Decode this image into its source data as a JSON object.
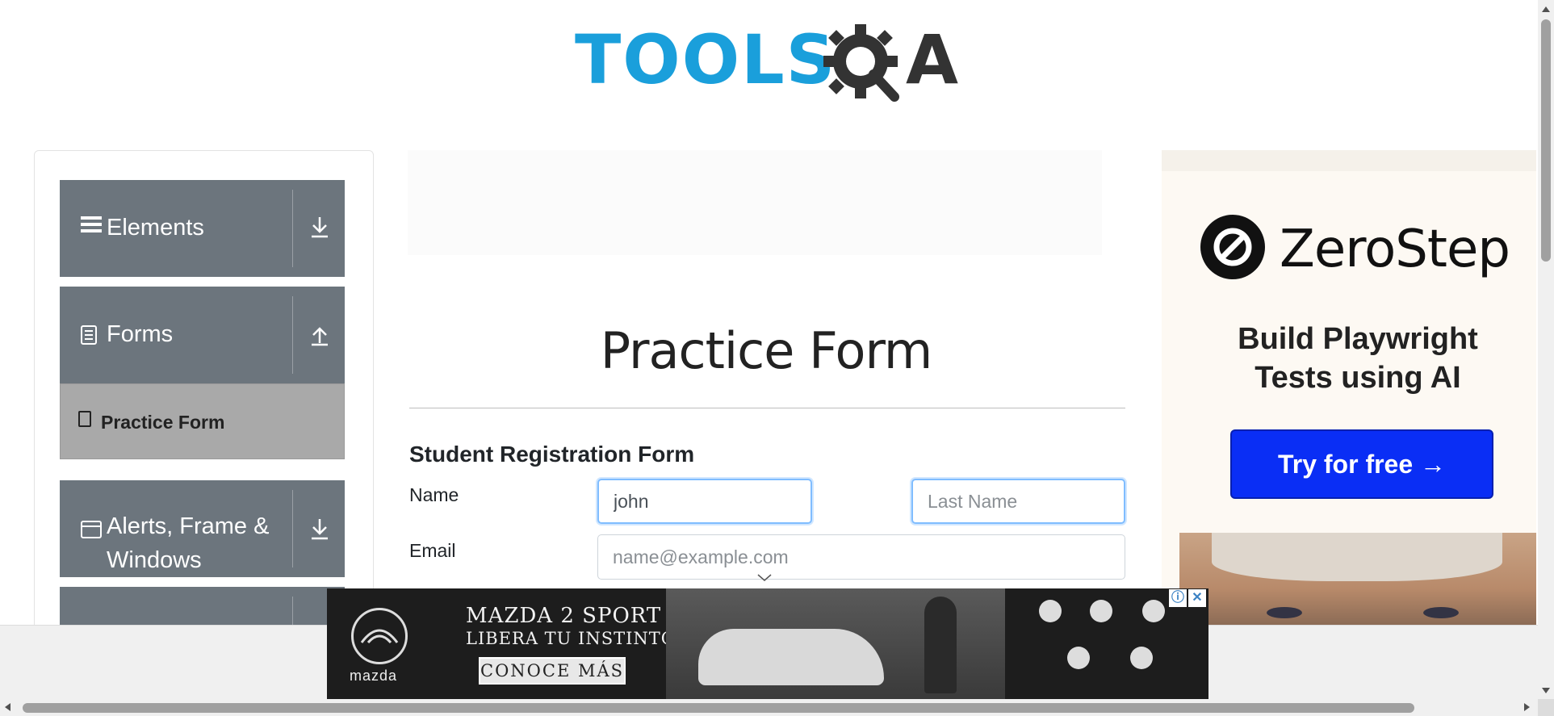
{
  "logo": {
    "text": "TOOLS",
    "suffix": "A"
  },
  "sidebar": {
    "groups": [
      {
        "label": "Elements",
        "icon": "hamburger-icon",
        "arrow": "download-arrow-icon"
      },
      {
        "label": "Forms",
        "icon": "document-icon",
        "arrow": "upload-arrow-icon"
      },
      {
        "label": "Alerts, Frame &",
        "label2": "Windows",
        "icon": "window-icon",
        "arrow": "download-arrow-icon"
      }
    ],
    "active_item": {
      "label": "Practice Form",
      "icon": "html5-icon"
    }
  },
  "main": {
    "title": "Practice Form",
    "form_heading": "Student Registration Form",
    "name_label": "Name",
    "email_label": "Email",
    "first_name_value": "john",
    "last_name_placeholder": "Last Name",
    "email_placeholder": "name@example.com"
  },
  "ad_right": {
    "brand": "ZeroStep",
    "tagline_1": "Build Playwright",
    "tagline_2": "Tests using AI",
    "cta": "Try for free →"
  },
  "ad_bottom": {
    "headline_1": "MAZDA 2 SPORT",
    "headline_2": "LIBERA TU INSTINTO",
    "cta": "CONOCE MÁS",
    "brand": "mazda",
    "info_icon": "ⓘ",
    "close_icon": "✕"
  },
  "colors": {
    "sidebar_group": "#6c757d",
    "active_item": "#a9a9a9",
    "logo_blue": "#1a9fdb",
    "ad_cta": "#0a2ef5"
  }
}
